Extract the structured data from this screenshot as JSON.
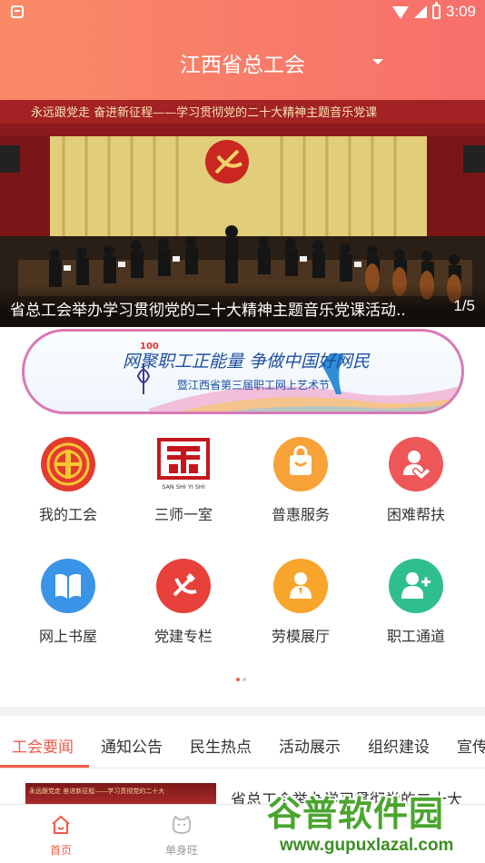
{
  "status_bar": {
    "time": "3:09"
  },
  "header": {
    "title": "江西省总工会"
  },
  "banner": {
    "slogan": "永远跟党走 奋进新征程——学习贯彻党的二十大精神主题音乐党课",
    "caption": "省总工会举办学习贯彻党的二十大精神主题音乐党课活动..",
    "counter": "1/5"
  },
  "promo": {
    "headline": "网聚职工正能量 争做中国好网民",
    "subtitle": "暨江西省第三届职工网上艺术节"
  },
  "grid": {
    "items": [
      {
        "label": "我的工会",
        "icon": "union-emblem-icon",
        "color": "#e43a2f"
      },
      {
        "label": "三师一室",
        "icon": "three-teachers-logo-icon",
        "color": "#c4161c",
        "logo_caption": "SAN SHI YI SHI"
      },
      {
        "label": "普惠服务",
        "icon": "shopping-bag-icon",
        "color": "#f8a23a"
      },
      {
        "label": "困难帮扶",
        "icon": "helping-hand-icon",
        "color": "#ee5758"
      },
      {
        "label": "网上书屋",
        "icon": "book-icon",
        "color": "#3a95e8"
      },
      {
        "label": "党建专栏",
        "icon": "party-emblem-icon",
        "color": "#e8403a"
      },
      {
        "label": "劳模展厅",
        "icon": "model-worker-icon",
        "color": "#f7a52b"
      },
      {
        "label": "职工通道",
        "icon": "worker-channel-icon",
        "color": "#2fbf8f"
      }
    ]
  },
  "pager": {
    "active_color": "#f05a48",
    "inactive_color": "#cccccc"
  },
  "news_tabs": [
    "工会要闻",
    "通知公告",
    "民生热点",
    "活动展示",
    "组织建设",
    "宣传"
  ],
  "news": {
    "thumb_text": "永远跟党走 奋进新征程——学习贯彻党的二十大",
    "first_title": "省总工会举办学习贯彻党的二十大"
  },
  "bottom_nav": [
    {
      "label": "首页",
      "icon": "home-icon",
      "active": true
    },
    {
      "label": "单身旺",
      "icon": "singles-icon",
      "active": false
    }
  ],
  "watermark": {
    "text": "谷普软件园",
    "url": "www.gupuxlazal.com"
  },
  "colors": {
    "accent": "#f05a48",
    "header_start": "#fa8a67",
    "header_end": "#f76f6b"
  }
}
